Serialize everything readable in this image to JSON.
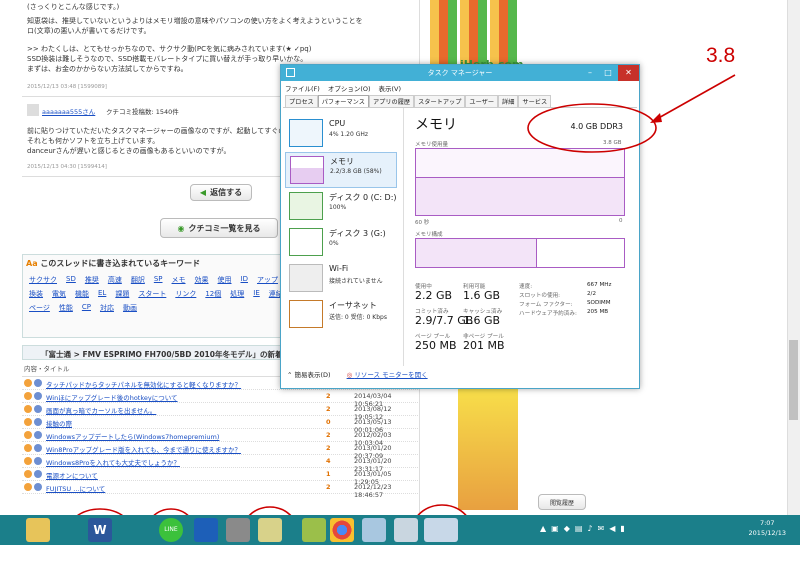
{
  "page": {
    "lines": [
      "(さっくりとこんな感じです。)",
      "知恵袋は、推奨していないというよりはメモリ増設の意味やパソコンの使い方をよく考えようということを",
      "ロ(文章)の悪い人が書いてるだけです。",
      ">> わたくしは、とてもせっかちなので、サクサク動(PCを気に病みされています(★ ✓pq)",
      "SSD換装は難しそうなので、SSD搭載モバレートタイプに買い替えが手っ取り早いかな。",
      "まずは、お金のかからない方法試してからですね。"
    ],
    "meta1": "2015/12/13 03:48 [1599089]",
    "user": "aaaaaaa555さん",
    "kuchikomi": "クチコミ投稿数: 1540件",
    "lines2": [
      "前に貼りつけていただいたタスクマネージャーの画像なのですが、起動してすぐの状態",
      "それとも何かソフトを立ち上げています。",
      "danceurさんが遅いと感じるときの画像もあるといいのですが。"
    ],
    "meta2": "2015/12/13 04:30 [1599414]",
    "reply_btn": "返信する",
    "list_btn": "クチコミ一覧を見る",
    "kw_title": "このスレッドに書き込まれているキーワード",
    "keywords": [
      "サクサク",
      "SD",
      "推奨",
      "高速",
      "翻訳",
      "SP",
      "メモ",
      "効果",
      "使用",
      "ID",
      "アップ",
      "特打",
      "省電力",
      "バランス",
      "初めて",
      "換装",
      "電気",
      "機能",
      "EL",
      "課題",
      "スタート",
      "リンク",
      "12個",
      "処理",
      "IE",
      "連結",
      "パーツ",
      "2枚",
      "処理",
      "取扱説明書",
      "ページ",
      "性能",
      "CP",
      "対応",
      "動画"
    ],
    "thread_title": "「富士通 > FMV ESPRIMO FH700/5BD 2010年冬モデル」の新着クチコミ",
    "thread_head": "内容・タイトル",
    "threads": [
      {
        "t": "タッチパッドからタッチパネルを無効化にすると軽くなりますか？",
        "c": "",
        "d": ""
      },
      {
        "t": "Winほにアップグレード後のhotkeyについて",
        "c": "2",
        "d": "2014/03/04 10:56:21"
      },
      {
        "t": "画面が真っ暗でカーソルを出ません。",
        "c": "2",
        "d": "2013/08/12 19:05:12"
      },
      {
        "t": "接触の際",
        "c": "0",
        "d": "2013/05/13 00:01:06"
      },
      {
        "t": "Windowsアップデートしたら(Windows7homepremium)",
        "c": "2",
        "d": "2012/02/03 10:03:04"
      },
      {
        "t": "Win8Proアップグレード版を入れても、今まで通りに使えますか？",
        "c": "2",
        "d": "2013/01/20 20:37:09"
      },
      {
        "t": "Windows8Proを入れても大丈夫でしょうか？",
        "c": "4",
        "d": "2013/01/20 23:31:17"
      },
      {
        "t": "電源オンについて",
        "c": "1",
        "d": "2013/01/05 1:29:05"
      },
      {
        "t": "FUJITSU ...について",
        "c": "2",
        "d": "2012/12/23 18:46:57"
      }
    ],
    "ad_text": "iHerb.com",
    "history_btn": "閲覧履歴"
  },
  "tm": {
    "title": "タスク マネージャー",
    "menu": [
      "ファイル(F)",
      "オプション(O)",
      "表示(V)"
    ],
    "tabs": [
      "プロセス",
      "パフォーマンス",
      "アプリの履歴",
      "スタートアップ",
      "ユーザー",
      "詳細",
      "サービス"
    ],
    "side": [
      {
        "name": "CPU",
        "sub": "4% 1.20 GHz"
      },
      {
        "name": "メモリ",
        "sub": "2.2/3.8 GB (58%)"
      },
      {
        "name": "ディスク 0 (C: D:)",
        "sub": "100%"
      },
      {
        "name": "ディスク 3 (G:)",
        "sub": "0%"
      },
      {
        "name": "Wi-Fi",
        "sub": "接続されていません"
      },
      {
        "name": "イーサネット",
        "sub": "送信: 0 受信: 0 Kbps"
      }
    ],
    "heading": "メモリ",
    "total": "4.0 GB DDR3",
    "usage_label": "メモリ使用量",
    "usage_max": "3.8 GB",
    "time_label": "60 秒",
    "zero": "0",
    "comp_label": "メモリ構成",
    "usage_fraction": 0.58,
    "stats": [
      {
        "label": "使用中",
        "value": "2.2 GB"
      },
      {
        "label": "利用可能",
        "value": "1.6 GB"
      },
      {
        "label": "コミット済み",
        "value": "2.9/7.7 GB"
      },
      {
        "label": "キャッシュ済み",
        "value": "1.6 GB"
      },
      {
        "label": "ページ プール",
        "value": "250 MB"
      },
      {
        "label": "非ページ プール",
        "value": "201 MB"
      }
    ],
    "right": [
      {
        "label": "速度:",
        "value": "667 MHz"
      },
      {
        "label": "スロットの使用:",
        "value": "2/2"
      },
      {
        "label": "フォーム ファクター:",
        "value": "SODIMM"
      },
      {
        "label": "ハードウェア予約済み:",
        "value": "205 MB"
      }
    ],
    "less": "簡易表示(D)",
    "monitor": "リソース モニターを開く"
  },
  "annotation": "3.8",
  "colors": {
    "accent": "#42b0d6",
    "memory": "#a95cc4",
    "annotation": "#cc0000",
    "taskbar": "#1b7f8a"
  },
  "taskbar": {
    "time": "7:07",
    "date": "2015/12/13"
  }
}
